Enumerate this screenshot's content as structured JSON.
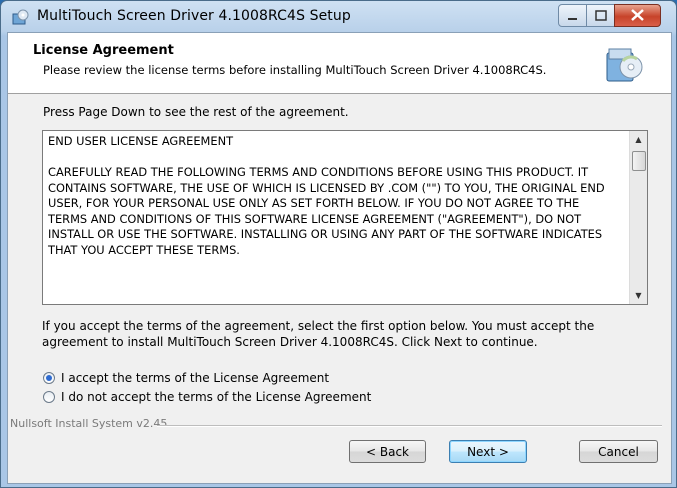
{
  "window": {
    "title": "MultiTouch Screen Driver 4.1008RC4S Setup",
    "controls": [
      "minimize",
      "maximize",
      "close"
    ]
  },
  "header": {
    "title": "License Agreement",
    "subtitle": "Please review the license terms before installing MultiTouch Screen Driver 4.1008RC4S."
  },
  "intro": "Press Page Down to see the rest of the agreement.",
  "eula_text": "END USER LICENSE AGREEMENT\n\nCAREFULLY READ THE FOLLOWING TERMS AND CONDITIONS BEFORE USING THIS PRODUCT. IT CONTAINS SOFTWARE, THE USE OF WHICH IS LICENSED BY .COM (\"\") TO YOU, THE ORIGINAL END USER, FOR YOUR PERSONAL USE ONLY AS SET FORTH BELOW. IF YOU DO NOT AGREE TO THE TERMS AND CONDITIONS OF THIS SOFTWARE LICENSE AGREEMENT (\"AGREEMENT\"), DO NOT INSTALL OR USE THE SOFTWARE. INSTALLING OR USING ANY PART OF THE SOFTWARE INDICATES THAT YOU ACCEPT THESE TERMS.",
  "accept_note": "If you accept the terms of the agreement, select the first option below. You must accept the agreement to install MultiTouch Screen Driver 4.1008RC4S. Click Next to continue.",
  "options": {
    "accept": "I accept the terms of the License Agreement",
    "decline": "I do not accept the terms of the License Agreement",
    "selected": "accept"
  },
  "branding": "Nullsoft Install System v2.45",
  "buttons": {
    "back": "< Back",
    "next": "Next >",
    "cancel": "Cancel"
  },
  "colors": {
    "titlebar": "#b9d1ea",
    "close_button": "#c7432a",
    "default_button_border": "#3c7fb1"
  }
}
